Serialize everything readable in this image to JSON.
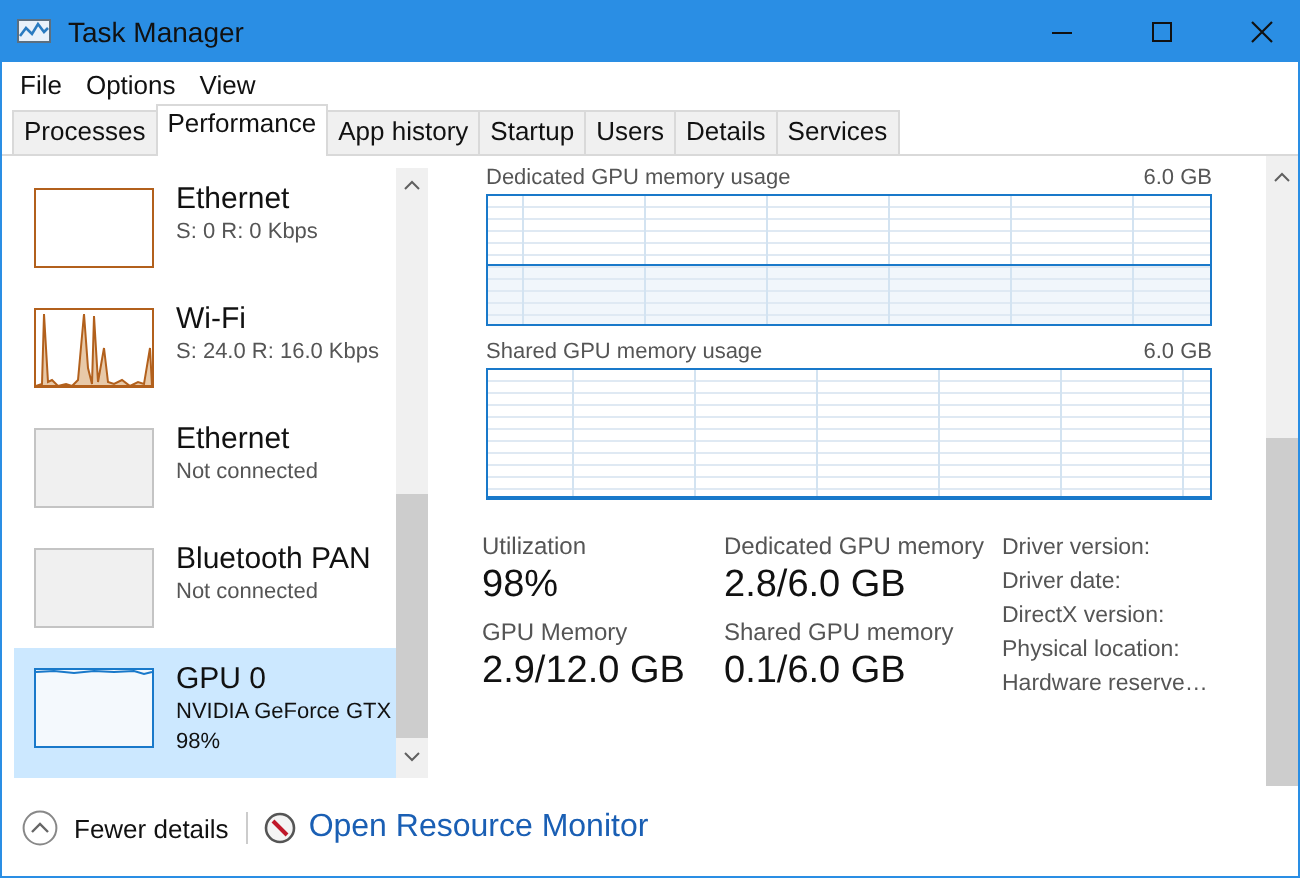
{
  "window": {
    "title": "Task Manager"
  },
  "menu": [
    "File",
    "Options",
    "View"
  ],
  "tabs": [
    {
      "label": "Processes",
      "selected": false
    },
    {
      "label": "Performance",
      "selected": true
    },
    {
      "label": "App history",
      "selected": false
    },
    {
      "label": "Startup",
      "selected": false
    },
    {
      "label": "Users",
      "selected": false
    },
    {
      "label": "Details",
      "selected": false
    },
    {
      "label": "Services",
      "selected": false
    }
  ],
  "sidebar": {
    "items": [
      {
        "kind": "idle",
        "name": "Ethernet",
        "details": [
          "S: 0 R: 0 Kbps"
        ],
        "selected": false
      },
      {
        "kind": "busy",
        "name": "Wi-Fi",
        "details": [
          "S: 24.0 R: 16.0 Kbps"
        ],
        "selected": false
      },
      {
        "kind": "disconnected",
        "name": "Ethernet",
        "details": [
          "Not connected"
        ],
        "selected": false
      },
      {
        "kind": "disconnected",
        "name": "Bluetooth PAN",
        "details": [
          "Not connected"
        ],
        "selected": false
      },
      {
        "kind": "gpu",
        "name": "GPU 0",
        "details": [
          "NVIDIA GeForce GTX",
          "98%"
        ],
        "selected": true
      }
    ]
  },
  "gpu_panel": {
    "graphs": [
      {
        "label": "Dedicated GPU memory usage",
        "max": "6.0 GB",
        "kind": "in-use"
      },
      {
        "label": "Shared GPU memory usage",
        "max": "6.0 GB",
        "kind": "idle"
      }
    ],
    "stats": [
      {
        "label": "Utilization",
        "value": "98%"
      },
      {
        "label": "Dedicated GPU memory",
        "value": "2.8/6.0 GB"
      },
      {
        "label": "GPU Memory",
        "value": "2.9/12.0 GB"
      },
      {
        "label": "Shared GPU memory",
        "value": "0.1/6.0 GB"
      }
    ],
    "properties": [
      "Driver version:",
      "Driver date:",
      "DirectX version:",
      "Physical location:",
      "Hardware reserve…"
    ]
  },
  "footer": {
    "toggle": "Fewer details",
    "link": "Open Resource Monitor"
  }
}
